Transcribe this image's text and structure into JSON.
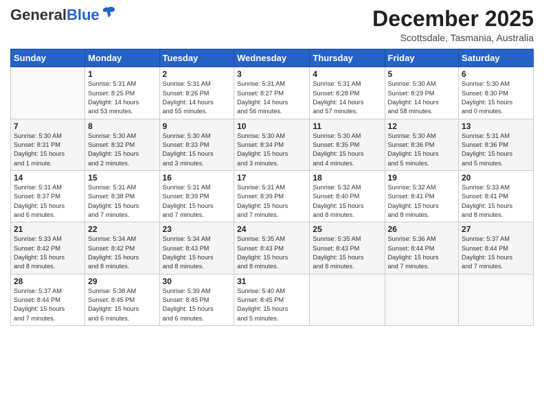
{
  "header": {
    "logo_general": "General",
    "logo_blue": "Blue",
    "month_title": "December 2025",
    "subtitle": "Scottsdale, Tasmania, Australia"
  },
  "weekdays": [
    "Sunday",
    "Monday",
    "Tuesday",
    "Wednesday",
    "Thursday",
    "Friday",
    "Saturday"
  ],
  "weeks": [
    [
      {
        "day": "",
        "info": ""
      },
      {
        "day": "1",
        "info": "Sunrise: 5:31 AM\nSunset: 8:25 PM\nDaylight: 14 hours\nand 53 minutes."
      },
      {
        "day": "2",
        "info": "Sunrise: 5:31 AM\nSunset: 8:26 PM\nDaylight: 14 hours\nand 55 minutes."
      },
      {
        "day": "3",
        "info": "Sunrise: 5:31 AM\nSunset: 8:27 PM\nDaylight: 14 hours\nand 56 minutes."
      },
      {
        "day": "4",
        "info": "Sunrise: 5:31 AM\nSunset: 8:28 PM\nDaylight: 14 hours\nand 57 minutes."
      },
      {
        "day": "5",
        "info": "Sunrise: 5:30 AM\nSunset: 8:29 PM\nDaylight: 14 hours\nand 58 minutes."
      },
      {
        "day": "6",
        "info": "Sunrise: 5:30 AM\nSunset: 8:30 PM\nDaylight: 15 hours\nand 0 minutes."
      }
    ],
    [
      {
        "day": "7",
        "info": "Sunrise: 5:30 AM\nSunset: 8:31 PM\nDaylight: 15 hours\nand 1 minute."
      },
      {
        "day": "8",
        "info": "Sunrise: 5:30 AM\nSunset: 8:32 PM\nDaylight: 15 hours\nand 2 minutes."
      },
      {
        "day": "9",
        "info": "Sunrise: 5:30 AM\nSunset: 8:33 PM\nDaylight: 15 hours\nand 3 minutes."
      },
      {
        "day": "10",
        "info": "Sunrise: 5:30 AM\nSunset: 8:34 PM\nDaylight: 15 hours\nand 3 minutes."
      },
      {
        "day": "11",
        "info": "Sunrise: 5:30 AM\nSunset: 8:35 PM\nDaylight: 15 hours\nand 4 minutes."
      },
      {
        "day": "12",
        "info": "Sunrise: 5:30 AM\nSunset: 8:36 PM\nDaylight: 15 hours\nand 5 minutes."
      },
      {
        "day": "13",
        "info": "Sunrise: 5:31 AM\nSunset: 8:36 PM\nDaylight: 15 hours\nand 5 minutes."
      }
    ],
    [
      {
        "day": "14",
        "info": "Sunrise: 5:31 AM\nSunset: 8:37 PM\nDaylight: 15 hours\nand 6 minutes."
      },
      {
        "day": "15",
        "info": "Sunrise: 5:31 AM\nSunset: 8:38 PM\nDaylight: 15 hours\nand 7 minutes."
      },
      {
        "day": "16",
        "info": "Sunrise: 5:31 AM\nSunset: 8:39 PM\nDaylight: 15 hours\nand 7 minutes."
      },
      {
        "day": "17",
        "info": "Sunrise: 5:31 AM\nSunset: 8:39 PM\nDaylight: 15 hours\nand 7 minutes."
      },
      {
        "day": "18",
        "info": "Sunrise: 5:32 AM\nSunset: 8:40 PM\nDaylight: 15 hours\nand 8 minutes."
      },
      {
        "day": "19",
        "info": "Sunrise: 5:32 AM\nSunset: 8:41 PM\nDaylight: 15 hours\nand 8 minutes."
      },
      {
        "day": "20",
        "info": "Sunrise: 5:33 AM\nSunset: 8:41 PM\nDaylight: 15 hours\nand 8 minutes."
      }
    ],
    [
      {
        "day": "21",
        "info": "Sunrise: 5:33 AM\nSunset: 8:42 PM\nDaylight: 15 hours\nand 8 minutes."
      },
      {
        "day": "22",
        "info": "Sunrise: 5:34 AM\nSunset: 8:42 PM\nDaylight: 15 hours\nand 8 minutes."
      },
      {
        "day": "23",
        "info": "Sunrise: 5:34 AM\nSunset: 8:43 PM\nDaylight: 15 hours\nand 8 minutes."
      },
      {
        "day": "24",
        "info": "Sunrise: 5:35 AM\nSunset: 8:43 PM\nDaylight: 15 hours\nand 8 minutes."
      },
      {
        "day": "25",
        "info": "Sunrise: 5:35 AM\nSunset: 8:43 PM\nDaylight: 15 hours\nand 8 minutes."
      },
      {
        "day": "26",
        "info": "Sunrise: 5:36 AM\nSunset: 8:44 PM\nDaylight: 15 hours\nand 7 minutes."
      },
      {
        "day": "27",
        "info": "Sunrise: 5:37 AM\nSunset: 8:44 PM\nDaylight: 15 hours\nand 7 minutes."
      }
    ],
    [
      {
        "day": "28",
        "info": "Sunrise: 5:37 AM\nSunset: 8:44 PM\nDaylight: 15 hours\nand 7 minutes."
      },
      {
        "day": "29",
        "info": "Sunrise: 5:38 AM\nSunset: 8:45 PM\nDaylight: 15 hours\nand 6 minutes."
      },
      {
        "day": "30",
        "info": "Sunrise: 5:39 AM\nSunset: 8:45 PM\nDaylight: 15 hours\nand 6 minutes."
      },
      {
        "day": "31",
        "info": "Sunrise: 5:40 AM\nSunset: 8:45 PM\nDaylight: 15 hours\nand 5 minutes."
      },
      {
        "day": "",
        "info": ""
      },
      {
        "day": "",
        "info": ""
      },
      {
        "day": "",
        "info": ""
      }
    ]
  ]
}
